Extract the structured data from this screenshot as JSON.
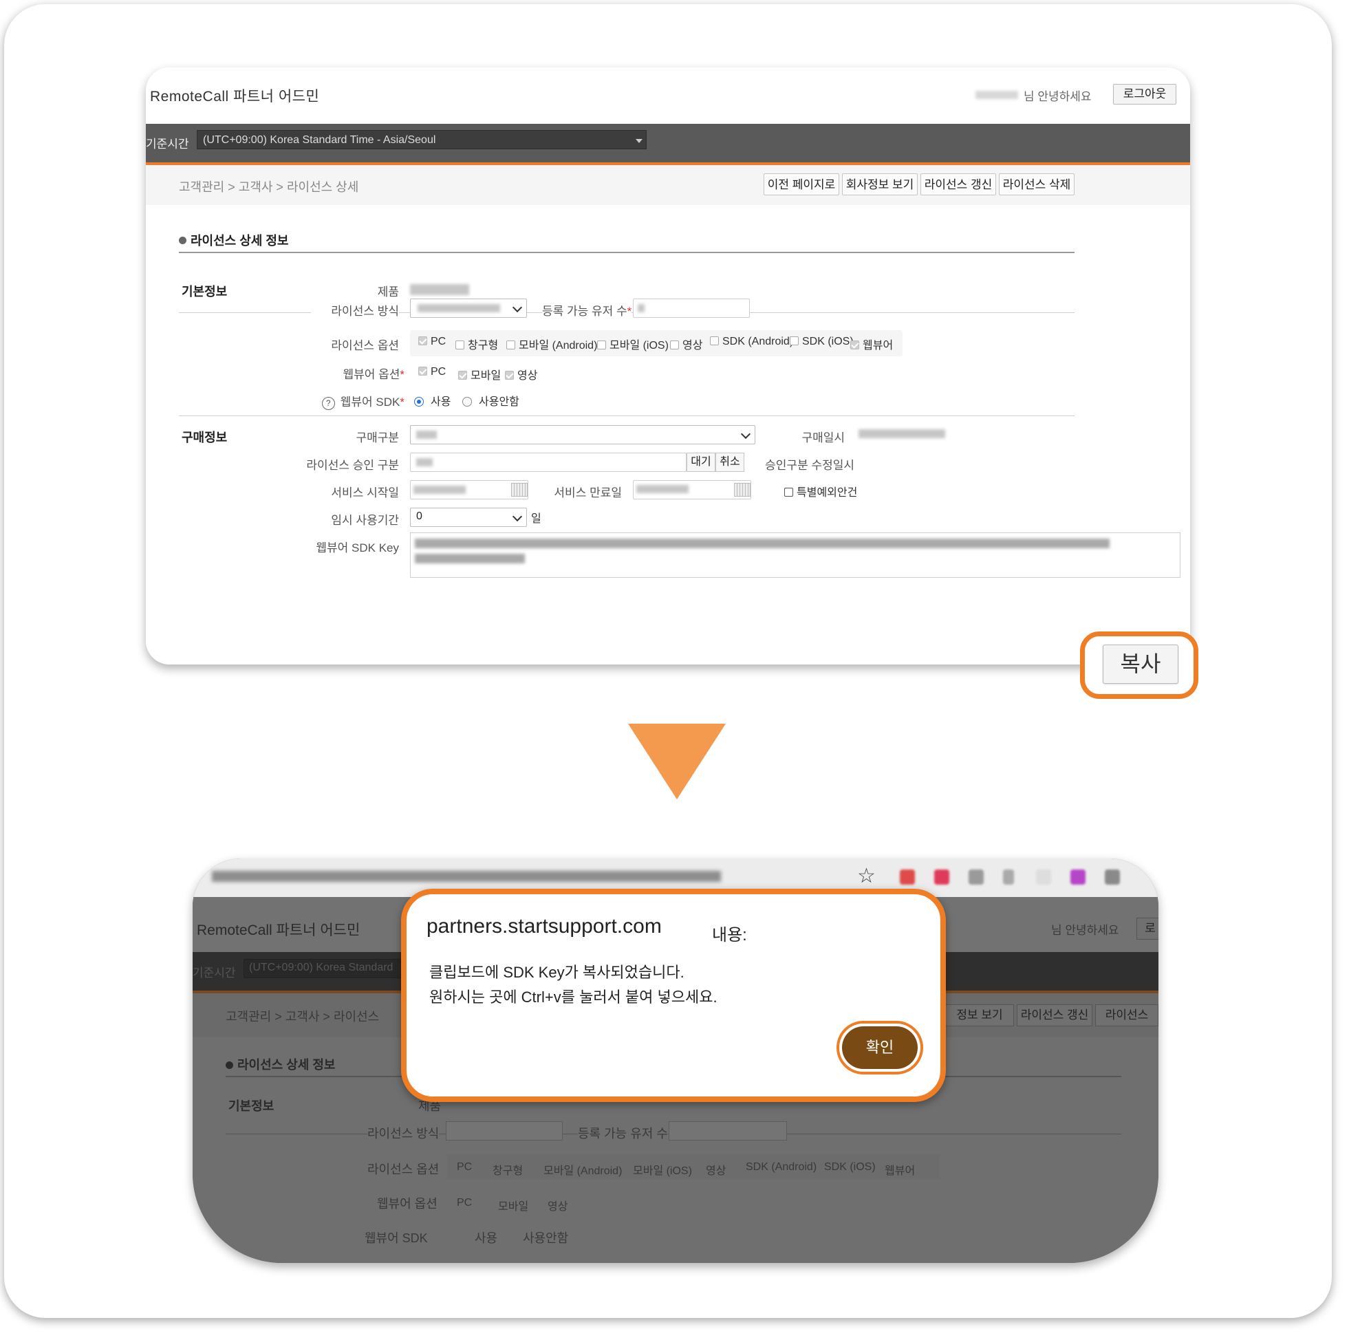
{
  "app": {
    "title": "RemoteCall 파트너 어드민",
    "greeting": "님 안녕하세요",
    "logout_label": "로그아웃"
  },
  "timezone": {
    "label": "기준시간",
    "value": "(UTC+09:00) Korea Standard Time - Asia/Seoul"
  },
  "breadcrumb": "고객관리 > 고객사 > 라이선스 상세",
  "actions": {
    "prev": "이전 페이지로",
    "company": "회사정보 보기",
    "renew": "라이선스 갱신",
    "delete": "라이선스 삭제"
  },
  "section_title": "라이선스 상세 정보",
  "basic": {
    "group_label": "기본정보",
    "product_label": "제품",
    "method_label": "라이선스 방식",
    "users_label": "등록 가능 유저 수",
    "options_label": "라이선스 옵션",
    "options": [
      {
        "label": "PC",
        "checked": true
      },
      {
        "label": "창구형",
        "checked": false
      },
      {
        "label": "모바일 (Android)",
        "checked": false
      },
      {
        "label": "모바일 (iOS)",
        "checked": false
      },
      {
        "label": "영상",
        "checked": false
      },
      {
        "label": "SDK (Android)",
        "checked": false
      },
      {
        "label": "SDK (iOS)",
        "checked": false
      },
      {
        "label": "웹뷰어",
        "checked": true
      }
    ],
    "webviewer_label": "웹뷰어 옵션",
    "webviewer_options": [
      {
        "label": "PC",
        "checked": true
      },
      {
        "label": "모바일",
        "checked": true
      },
      {
        "label": "영상",
        "checked": true
      }
    ],
    "sdk_label": "웹뷰어 SDK",
    "sdk_use": "사용",
    "sdk_nouse": "사용안함",
    "help_icon": "?",
    "required_mark": "*"
  },
  "purchase": {
    "group_label": "구매정보",
    "type_label": "구매구분",
    "date_label": "구매일시",
    "approval_label": "라이선스 승인 구분",
    "wait_btn": "대기",
    "cancel_btn": "취소",
    "approval_date_label": "승인구분 수정일시",
    "start_label": "서비스 시작일",
    "end_label": "서비스 만료일",
    "special_label": "특별예외안건",
    "temp_label": "임시 사용기간",
    "temp_value": "0",
    "temp_unit": "일",
    "sdk_key_label": "웹뷰어 SDK Key"
  },
  "copy_button": "복사",
  "dialog": {
    "host": "partners.startsupport.com",
    "suffix": "내용:",
    "line1": "클립보드에 SDK Key가 복사되었습니다.",
    "line2": "원하시는 곳에 Ctrl+v를 눌러서 붙여 넣으세요.",
    "ok": "확인"
  },
  "background_page": {
    "title": "RemoteCall 파트너 어드민",
    "greeting": "님 안녕하세요",
    "logout_partial": "로",
    "tz_label": "기준시간",
    "tz_value": "(UTC+09:00) Korea Standard",
    "breadcrumb": "고객관리 > 고객사 > 라이선스",
    "btn_company_partial": "정보 보기",
    "btn_renew": "라이선스 갱신",
    "btn_delete_partial": "라이선스",
    "section_title": "라이선스 상세 정보",
    "group_label": "기본정보",
    "product_partial": "제품",
    "method_label": "라이선스 방식",
    "users_label": "등록 가능 유저 수",
    "options_label": "라이선스 옵션",
    "options": [
      "PC",
      "창구형",
      "모바일 (Android)",
      "모바일 (iOS)",
      "영상",
      "SDK (Android)",
      "SDK (iOS)",
      "웹뷰어"
    ],
    "webviewer_label": "웹뷰어 옵션",
    "webviewer_options": [
      "PC",
      "모바일",
      "영상"
    ],
    "sdk_label": "웹뷰어 SDK",
    "sdk_use": "사용",
    "sdk_nouse": "사용안함"
  },
  "icons": {
    "bookmark": "star-icon",
    "arrow": "arrow-down-icon"
  },
  "colors": {
    "accent_orange": "#ef7d24",
    "arrow_orange": "#f39a4f",
    "ok_button": "#7a4a14",
    "radio_blue": "#1f6fe0"
  }
}
